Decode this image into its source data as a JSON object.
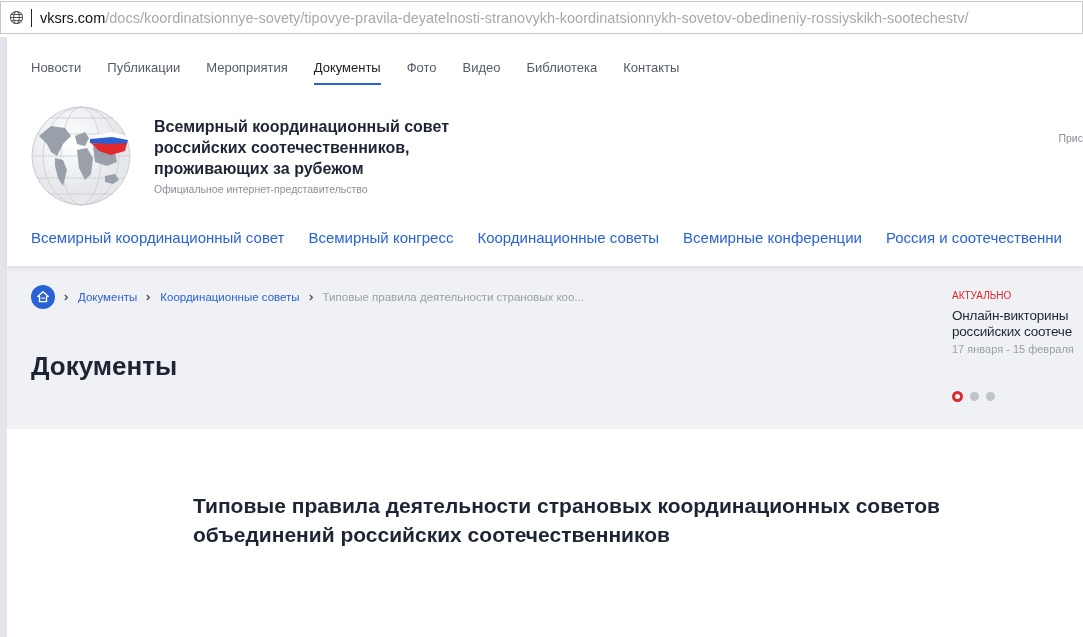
{
  "address_bar": {
    "domain": "vksrs.com",
    "path": "/docs/koordinatsionnye-sovety/tipovye-pravila-deyatelnosti-stranovykh-koordinatsionnykh-sovetov-obedineniy-rossiyskikh-sootechestv/"
  },
  "top_nav": [
    {
      "label": "Новости",
      "selected": false
    },
    {
      "label": "Публикации",
      "selected": false
    },
    {
      "label": "Мероприятия",
      "selected": false
    },
    {
      "label": "Документы",
      "selected": true
    },
    {
      "label": "Фото",
      "selected": false
    },
    {
      "label": "Видео",
      "selected": false
    },
    {
      "label": "Библиотека",
      "selected": false
    },
    {
      "label": "Контакты",
      "selected": false
    }
  ],
  "site": {
    "title": "Всемирный координационный совет российских соотечественников, проживающих за рубежом",
    "subtitle": "Официальное интернет-представительство",
    "right_text": "Прис"
  },
  "main_nav": [
    "Всемирный координационный совет",
    "Всемирный конгресс",
    "Координационные советы",
    "Всемирные конференции",
    "Россия и соотечественни"
  ],
  "breadcrumbs": [
    {
      "label": "Документы",
      "kind": "link"
    },
    {
      "label": "Координационные советы",
      "kind": "link"
    },
    {
      "label": "Типовые правила деятельности страновых коо...",
      "kind": "current"
    }
  ],
  "page_title": "Документы",
  "news": {
    "tag": "АКТУАЛЬНО",
    "title_lines": [
      "Онлайн-викторины",
      "российских соотече"
    ],
    "date": "17 января - 15 февраля",
    "dots": [
      {
        "selected": true
      },
      {
        "selected": false
      },
      {
        "selected": false
      }
    ]
  },
  "document_title": "Типовые правила деятельности страновых координационных советов объединений российских соотечественников"
}
